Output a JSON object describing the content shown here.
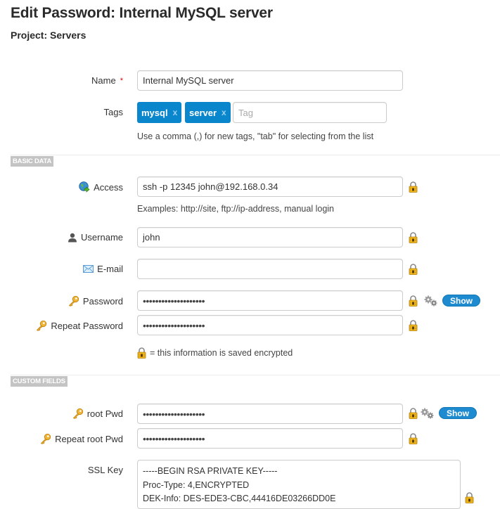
{
  "header": {
    "title": "Edit Password: Internal MySQL server",
    "project": "Project: Servers"
  },
  "form": {
    "name": {
      "label": "Name",
      "required_mark": "*",
      "value": "Internal MySQL server"
    },
    "tags": {
      "label": "Tags",
      "items": [
        {
          "label": "mysql",
          "remove": "x"
        },
        {
          "label": "server",
          "remove": "x"
        }
      ],
      "placeholder": "Tag",
      "help": "Use a comma (,) for new tags, \"tab\" for selecting from the list",
      "color": "#0a86cd"
    }
  },
  "basic_data": {
    "section_label": "BASIC DATA",
    "access": {
      "label": "Access",
      "icon": "globe-arrow-icon",
      "value": "ssh -p 12345 john@192.168.0.34",
      "help": "Examples: http://site, ftp://ip-address, manual login"
    },
    "username": {
      "label": "Username",
      "icon": "user-icon",
      "value": "john"
    },
    "email": {
      "label": "E-mail",
      "icon": "envelope-icon",
      "value": ""
    },
    "password": {
      "label": "Password",
      "icon": "key-icon",
      "value": "••••••••••••••••••••",
      "show_label": "Show"
    },
    "repeat_password": {
      "label": "Repeat Password",
      "icon": "key-icon",
      "value": "••••••••••••••••••••"
    },
    "encrypted_note": "= this information is saved encrypted"
  },
  "custom_fields": {
    "section_label": "CUSTOM FIELDS",
    "root_pwd": {
      "label": "root Pwd",
      "icon": "key-icon",
      "value": "••••••••••••••••••••",
      "show_label": "Show"
    },
    "repeat_root_pwd": {
      "label": "Repeat root Pwd",
      "icon": "key-icon",
      "value": "••••••••••••••••••••"
    },
    "ssl_key": {
      "label": "SSL Key",
      "lines": [
        "-----BEGIN RSA PRIVATE KEY-----",
        "Proc-Type: 4,ENCRYPTED",
        "DEK-Info: DES-EDE3-CBC,44416DE03266DD0E"
      ]
    }
  },
  "colors": {
    "accent": "#1e8bd0",
    "section_bg": "#c4c4c4",
    "required": "#dd0000"
  }
}
